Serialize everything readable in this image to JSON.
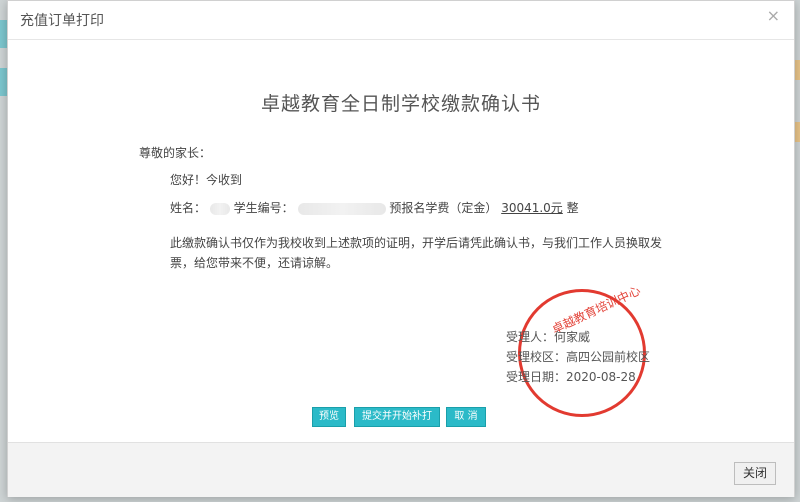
{
  "dialog": {
    "title": "充值订单打印",
    "close_glyph": "×"
  },
  "document": {
    "title": "卓越教育全日制学校缴款确认书",
    "salutation": "尊敬的家长：",
    "greeting": "您好！今收到",
    "name_label": "姓名：",
    "student_id_label": "学生编号：",
    "fee_label": "预报名学费（定金）",
    "amount": "30041.0元",
    "amount_suffix": "整",
    "notice": "此缴款确认书仅作为我校收到上述款项的证明，开学后请凭此确认书，与我们工作人员换取发票，给您带来不便，还请谅解。",
    "stamp_text": "卓越教育培训中心",
    "handler": "受理人：何家威",
    "campus": "受理校区：高四公园前校区",
    "date": "受理日期：2020-08-28"
  },
  "buttons": {
    "preview": "预览",
    "submit_reprint": "提交并开始补打",
    "cancel": "取 消",
    "close": "关闭"
  },
  "colors": {
    "accent": "#2bbac8",
    "stamp": "#e23a30"
  }
}
